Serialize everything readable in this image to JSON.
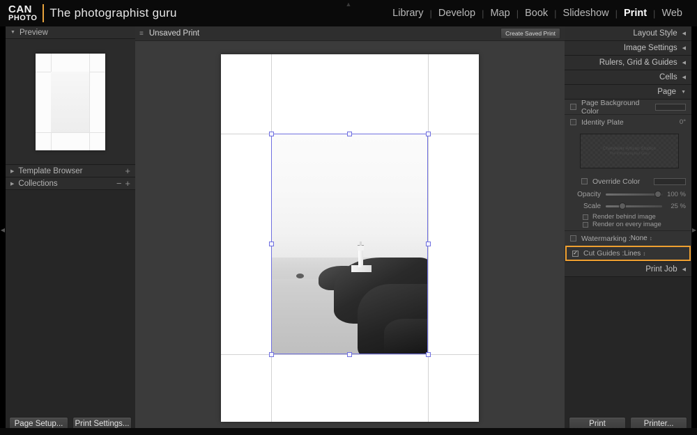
{
  "app": {
    "logo_line1": "CAN",
    "logo_line2": "PHOTO",
    "tagline": "The photographist guru"
  },
  "modules": [
    {
      "label": "Library",
      "active": false
    },
    {
      "label": "Develop",
      "active": false
    },
    {
      "label": "Map",
      "active": false
    },
    {
      "label": "Book",
      "active": false
    },
    {
      "label": "Slideshow",
      "active": false
    },
    {
      "label": "Print",
      "active": true
    },
    {
      "label": "Web",
      "active": false
    }
  ],
  "left_panel": {
    "preview": {
      "label": "Preview",
      "expanded_glyph": "▼"
    },
    "template_browser": {
      "label": "Template Browser",
      "collapsed_glyph": "▶",
      "add_glyph": "+"
    },
    "collections": {
      "label": "Collections",
      "collapsed_glyph": "▶",
      "minus_glyph": "−",
      "add_glyph": "+"
    },
    "page_setup_button": "Page Setup...",
    "print_settings_button": "Print Settings..."
  },
  "center": {
    "toolbar": {
      "disclosure_glyph": "≡",
      "title": "Unsaved Print",
      "create_saved_print_button": "Create Saved Print"
    },
    "photo": {
      "description": "black-and-white long-exposure seascape with lighthouse on rocky headland"
    }
  },
  "right_panel": {
    "headers": [
      {
        "label": "Layout Style",
        "glyph": "◀"
      },
      {
        "label": "Image Settings",
        "glyph": "◀"
      },
      {
        "label": "Rulers, Grid & Guides",
        "glyph": "◀"
      },
      {
        "label": "Cells",
        "glyph": "◀"
      },
      {
        "label": "Page",
        "glyph": "▼"
      }
    ],
    "page_background_color": {
      "label": "Page Background Color",
      "checked": false,
      "check_glyph": ""
    },
    "identity_plate": {
      "label": "Identity Plate",
      "checked": false,
      "angle": "0°",
      "preview_line1": "Chandelier Artisan Studios",
      "preview_line2": "The Photographist Guru",
      "override_color_label": "Override Color",
      "override_checked": false,
      "opacity_label": "Opacity",
      "opacity_value": "100 %",
      "opacity_pct": 100,
      "scale_label": "Scale",
      "scale_value": "25 %",
      "scale_pct": 25,
      "render_behind_label": "Render behind image",
      "render_behind_checked": false,
      "render_every_label": "Render on every image",
      "render_every_checked": false
    },
    "watermarking": {
      "label": "Watermarking :",
      "checked": false,
      "value": "None",
      "stepper_glyph": "↕"
    },
    "cut_guides": {
      "label": "Cut Guides :",
      "checked": true,
      "check_glyph": "✓",
      "value": "Lines",
      "stepper_glyph": "↕",
      "highlight_color": "#f0a030"
    },
    "print_job": {
      "label": "Print Job",
      "glyph": "◀"
    },
    "print_button": "Print",
    "printer_button": "Printer..."
  },
  "edges": {
    "top_arrow": "▲",
    "bottom_arrow": "▼",
    "left_arrow": "◀",
    "right_arrow": "▶"
  },
  "colors": {
    "accent_highlight": "#f0a030",
    "selection": "#6f6fe0",
    "panel_bg": "#262626",
    "canvas_bg": "#3b3b3b"
  }
}
